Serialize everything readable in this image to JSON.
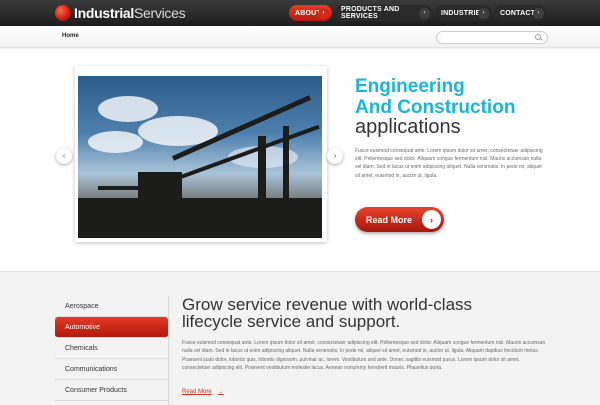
{
  "header": {
    "logo_bold": "Industrial",
    "logo_light": "Services",
    "nav": [
      {
        "label": "ABOUT",
        "active": true
      },
      {
        "label": "PRODUCTS AND SERVICES",
        "active": false
      },
      {
        "label": "INDUSTRIES",
        "active": false
      },
      {
        "label": "CONTACTS",
        "active": false
      }
    ]
  },
  "subbar": {
    "breadcrumb": "Home",
    "search_placeholder": ""
  },
  "hero": {
    "title_line1": "Engineering",
    "title_line2": "And Construction",
    "title_line3": "applications",
    "body": "Fusce euismod consequat ante. Lorem ipsum dolor sit amet, consectetuer adipiscing elit. Pellentesque sed dolor. Aliquam congue fermentum nisl. Mauris accumsan nulla vel diam. Sed in lacus ut enim adipiscing aliquet. Nulla venenatis. In pede mi, aliquet sit amet, euismod in, auctor ut, ligula.",
    "button_label": "Read More",
    "button_arrow": "›",
    "prev_arrow": "‹",
    "next_arrow": "›",
    "accent_color": "#18b6d9"
  },
  "side_nav": {
    "items": [
      {
        "label": "Aerospace",
        "active": false
      },
      {
        "label": "Automotive",
        "active": true
      },
      {
        "label": "Chemicals",
        "active": false
      },
      {
        "label": "Communications",
        "active": false
      },
      {
        "label": "Consumer Products",
        "active": false
      }
    ]
  },
  "section": {
    "title_line1": "Grow service revenue with world-class",
    "title_line2": "lifecycle service and support.",
    "body": "Fusce euismod consequat ante. Lorem ipsum dolor sit amet, consectetuer adipiscing elit. Pellentesque sed dolor. Aliquam congue fermentum nisl. Mauris accumsan nulla vel diam. Sed in lacus ut enim adipiscing aliquet. Nulla venenatis. In pede mi, aliquet sit amet, euismod in, auctor ut, ligula. Aliquam dapibus tincidunt metus. Praesent justo dolor, lobortis quis, lobortis dignissim, pulvinar ac, lorem. Vestibulum sed ante. Donec sagittis euismod purus. Lorem ipsum dolor sit amet, consectetuer adipiscing elit. Praesent vestibulum molestie lacus. Aenean nonummy hendrerit mauris. Phasellus porta.",
    "link_label": "Read More",
    "link_arrow": "→"
  },
  "colors": {
    "brand_red": "#d32a19",
    "accent_cyan": "#18b6d9"
  }
}
